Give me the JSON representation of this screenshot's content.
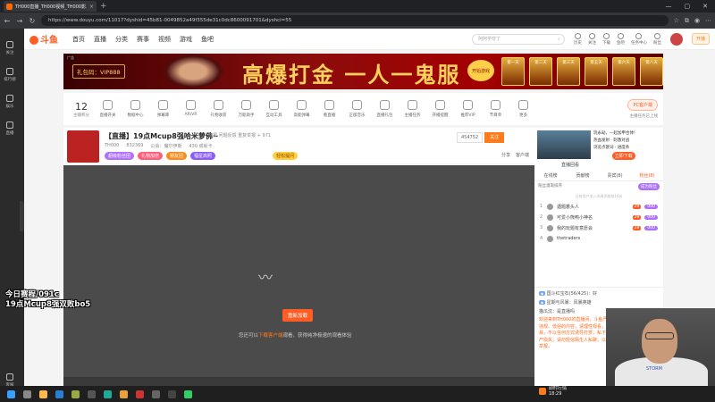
{
  "browser": {
    "tab_title": "TH000直播_TH000视频_TH000影...",
    "tab_close": "×",
    "new_tab": "+",
    "window_controls": [
      "—",
      "▢",
      "✕"
    ],
    "nav": [
      "←",
      "→",
      "↻"
    ],
    "url": "https://www.douyu.com/11017?dyshid=45b81-0049852a49f355de31c0dc8600091701&dyshci=55"
  },
  "left_rail": [
    {
      "icon": "heart-icon",
      "label": "关注"
    },
    {
      "icon": "list-icon",
      "label": "排行榜"
    },
    {
      "icon": "gift-icon",
      "label": "娱乐"
    },
    {
      "icon": "shop-icon",
      "label": "直播"
    },
    {
      "icon": "settings-icon",
      "label": "客服"
    }
  ],
  "header": {
    "logo": "斗鱼",
    "menu": [
      "首页",
      "直播",
      "分类",
      "赛事",
      "视频",
      "游戏",
      "鱼吧"
    ],
    "search_placeholder": "阿阿学夸了",
    "icons": [
      "历史",
      "关注",
      "下载",
      "鱼吧",
      "任务中心",
      "粉丝"
    ],
    "open_live": "开播"
  },
  "banner": {
    "ad": "广告",
    "gift_code": "礼包码：VIP888",
    "slogan": "高爆打金 一人一鬼服",
    "start": "开始游戏",
    "prizes": [
      "第一天",
      "第二天",
      "第三天",
      "第五天",
      "第六天",
      "第八天"
    ]
  },
  "toolbar": {
    "level": "12",
    "level_label": "主播积分",
    "items": [
      "直播开关",
      "数据中心",
      "弹幕库",
      "AR/VR",
      "礼物收获",
      "万能助手",
      "互动工具",
      "高能弹幕",
      "看直播",
      "正版音乐",
      "直播礼包",
      "主播任务",
      "开播提醒",
      "推荐VIP",
      "节目单",
      "更多"
    ],
    "pc_client": "PC客户端",
    "pc_sub": "主播任务已上线"
  },
  "room": {
    "title": "【直播】19点Mcup8强哈米萝佛~",
    "tag": "举报  问题反馈  重复举报 + 971",
    "streamer": "TH000",
    "hot": "832369",
    "guild": "公会：魔尔伊斯",
    "time": "430 成就卡",
    "badges": [
      "超级粉丝团",
      "礼物加倍",
      "朋友团",
      "福星高照"
    ],
    "ask_btn": "轻松提问",
    "follow_count": "454752",
    "follow": "关注",
    "tools": [
      "分享",
      "客户端"
    ]
  },
  "video": {
    "loader": "〰",
    "refresh": "重新加载",
    "tip_pre": "您还可以",
    "tip_link": "下载客户端",
    "tip_post": "观看，获得纯净极速的观看体验"
  },
  "side": {
    "promo_text": [
      "玩永劫，一起加甲合体!",
      "热血发射 · 刺激对战",
      "浏览点歌词 · 进度条"
    ],
    "promo_dl": "立即下载",
    "weekly": "直播回看",
    "tabs": [
      "在线榜",
      "贡献榜",
      "贵宾(8)",
      "粉丝(8)"
    ],
    "fans_label": "粉丝灌溉排序",
    "fans_btn": "成为粉丝",
    "hint": "当前用户加入本周贡献前10名",
    "ranks": [
      {
        "no": "1",
        "name": "遇题着头人",
        "lv": "29",
        "ct": "000"
      },
      {
        "no": "2",
        "name": "可爱小熊鸭小神名",
        "lv": "29",
        "ct": "000"
      },
      {
        "no": "3",
        "name": "我的玩题有意愿会",
        "lv": "28",
        "ct": "000"
      },
      {
        "no": "4",
        "name": "thetraders",
        "lv": "",
        "ct": ""
      }
    ],
    "chat": [
      "国斗红宝石(56/425)：好",
      "星期与风暴：风暴英雄",
      "猫瓜沈：是直播吗"
    ],
    "sys": "欢迎来到TH000的直播间。斗鱼严禁主播及用户发布违法、违规、低俗的内容，请理性观看，理性打赏。请勿私下交易，不以任何方式诱导打赏，私下交易及私人借贷产生的财产损失，请勿轻信陌生人私聊，以免上当受骗，如有违规请举报。"
  },
  "overlay": {
    "line1": "今日赛程/091c",
    "line2": "19点Mcup8强双败bo5"
  },
  "news": {
    "title": "即时行情",
    "sub": "18:29"
  },
  "webcam": {
    "shirt": "STORM"
  }
}
